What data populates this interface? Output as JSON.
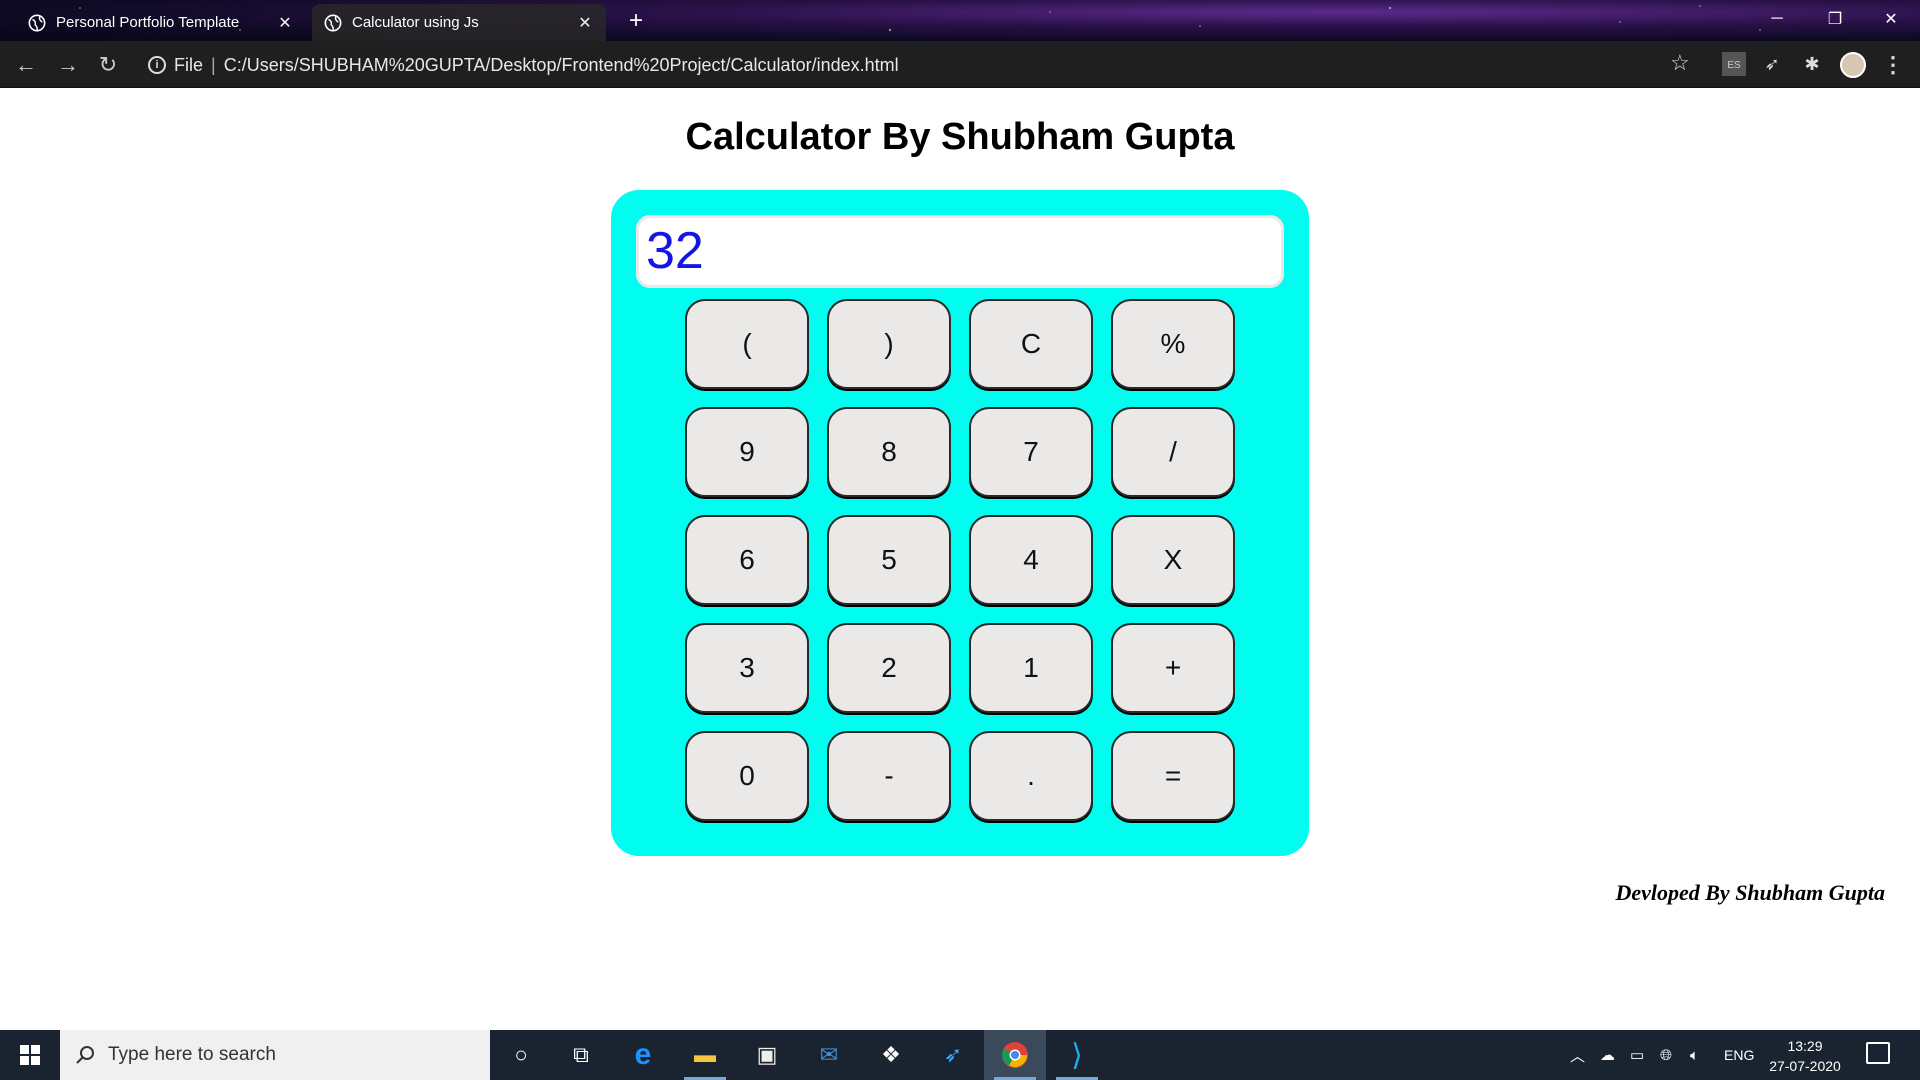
{
  "browser": {
    "tabs": [
      {
        "title": "Personal Portfolio Template",
        "active": false
      },
      {
        "title": "Calculator using Js",
        "active": true
      }
    ],
    "address": {
      "scheme_label": "File",
      "url": "C:/Users/SHUBHAM%20GUPTA/Desktop/Frontend%20Project/Calculator/index.html"
    },
    "extensions": {
      "es_label": "ES"
    }
  },
  "page": {
    "title": "Calculator By Shubham Gupta",
    "display_value": "32",
    "keys": [
      [
        "(",
        ")",
        "C",
        "%"
      ],
      [
        "9",
        "8",
        "7",
        "/"
      ],
      [
        "6",
        "5",
        "4",
        "X"
      ],
      [
        "3",
        "2",
        "1",
        "+"
      ],
      [
        "0",
        "-",
        ".",
        "="
      ]
    ],
    "credit": "Devloped By Shubham Gupta",
    "colors": {
      "calculator_body": "#00fdef",
      "display_text": "#1414e6",
      "key_face": "#ebe9e8"
    }
  },
  "taskbar": {
    "search_placeholder": "Type here to search",
    "language": "ENG",
    "time": "13:29",
    "date": "27-07-2020"
  }
}
